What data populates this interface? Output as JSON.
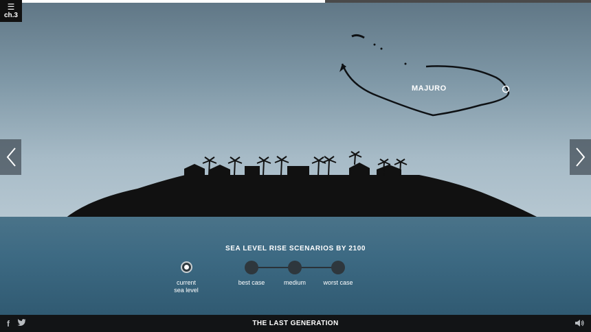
{
  "progress": {
    "fraction": 0.55
  },
  "chapter": {
    "menu_glyph": "☰",
    "label": "ch.3"
  },
  "nav": {
    "prev_glyph": "‹",
    "next_glyph": "›"
  },
  "atoll": {
    "label": "MAJURO"
  },
  "scenarios": {
    "title": "SEA LEVEL RISE SCENARIOS BY 2100",
    "current_label_line1": "current",
    "current_label_line2": "sea level",
    "best_case": "best case",
    "medium": "medium",
    "worst_case": "worst case"
  },
  "footer": {
    "title": "THE LAST GENERATION",
    "facebook_glyph": "f"
  },
  "colors": {
    "sky": "#7e97a6",
    "sea": "#3d6a83",
    "island": "#111111",
    "bar": "#121416"
  }
}
